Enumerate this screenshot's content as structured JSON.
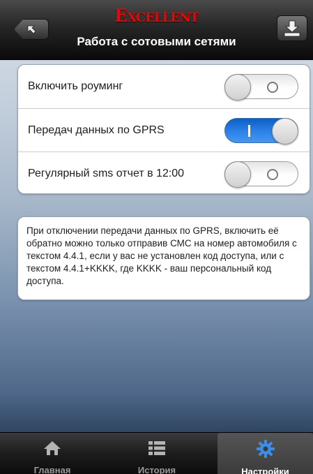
{
  "header": {
    "brand": "Excellent",
    "title": "Работа с сотовыми сетями",
    "back_icon": "arrow-up-left-icon",
    "download_icon": "download-icon"
  },
  "settings": {
    "rows": [
      {
        "label": "Включить роуминг",
        "enabled": false
      },
      {
        "label": "Передач данных по GPRS",
        "enabled": true
      },
      {
        "label": "Регулярный sms отчет в 12:00",
        "enabled": false
      }
    ]
  },
  "info": {
    "text": "При отключении передачи данных по GPRS, включить её обратно можно только отправив СМС на номер автомобиля с текстом 4.4.1, если у вас не установлен код доступа, или с текстом 4.4.1+KKKK, где KKKK - ваш персональный код доступа."
  },
  "tabs": [
    {
      "label": "Главная",
      "icon": "home-icon",
      "active": false
    },
    {
      "label": "История",
      "icon": "list-icon",
      "active": false
    },
    {
      "label": "Настройки",
      "icon": "gear-icon",
      "active": true
    }
  ],
  "colors": {
    "brand": "#e00a0a",
    "toggle_on": "#2f86ea",
    "gear_icon": "#3a8ee8"
  }
}
